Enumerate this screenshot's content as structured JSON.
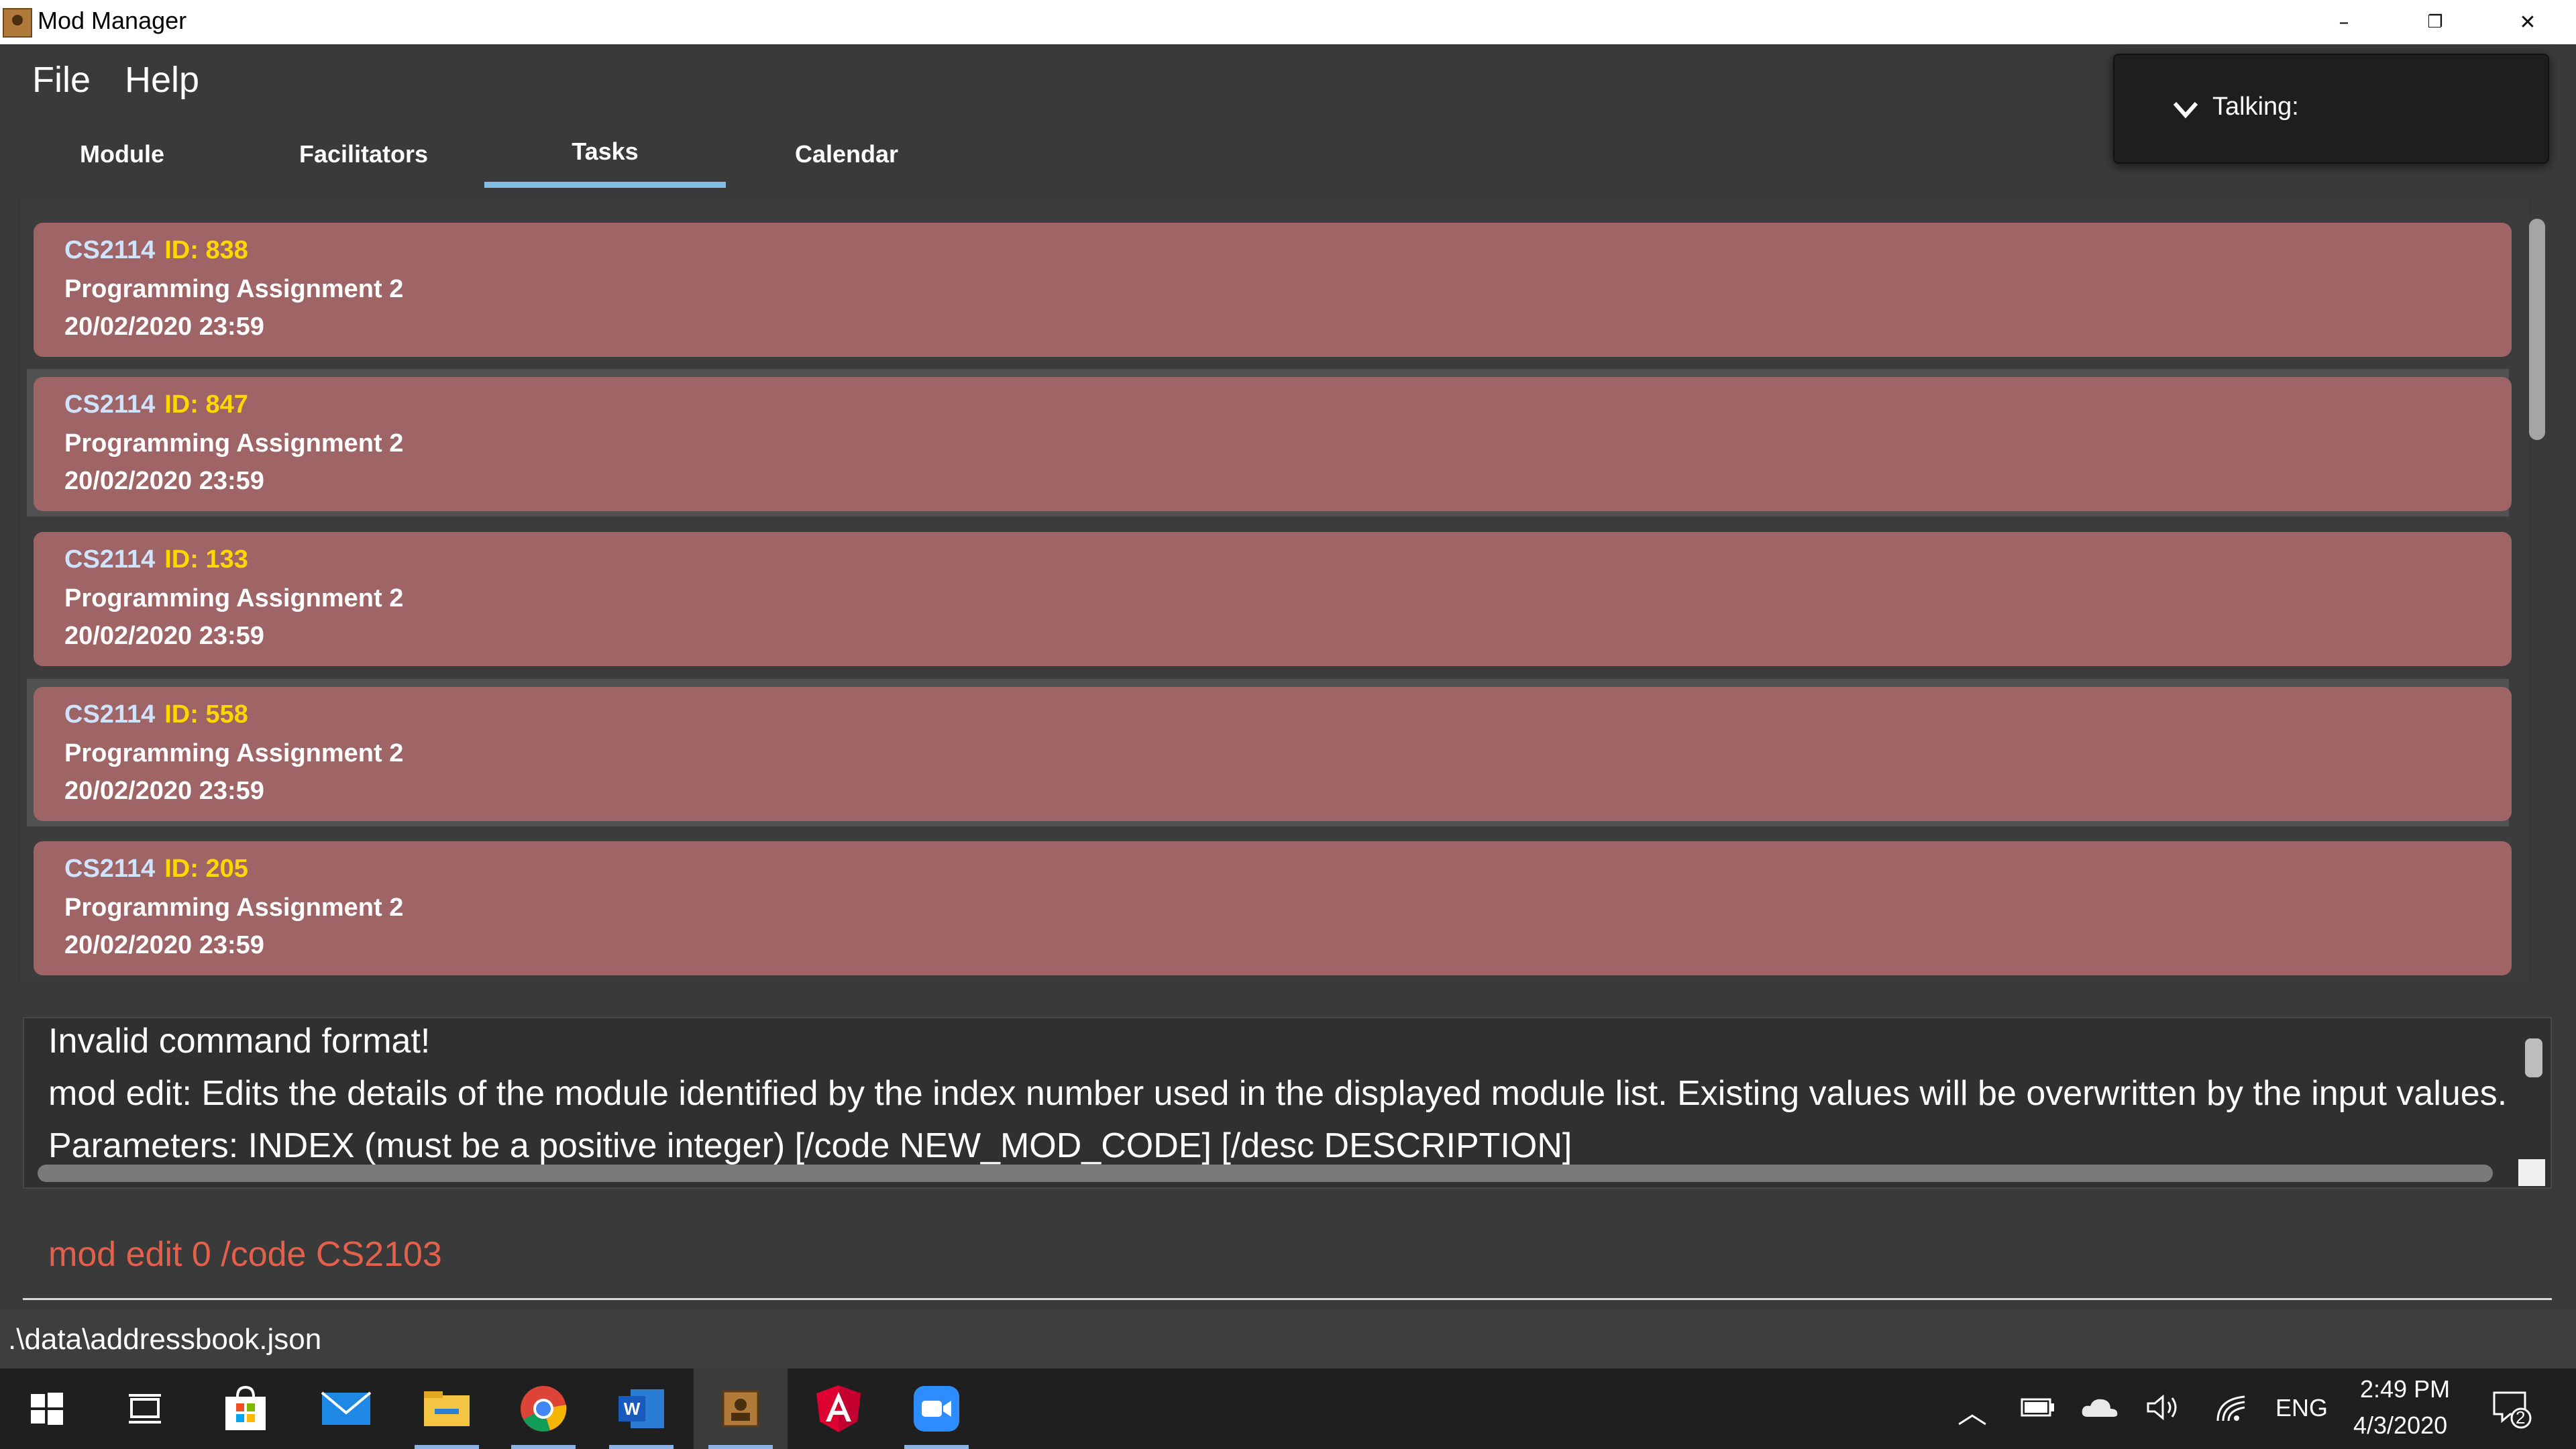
{
  "window": {
    "title": "Mod Manager",
    "minimize": "–",
    "restore": "❐",
    "close": "✕"
  },
  "menu": {
    "items": [
      "File",
      "Help"
    ]
  },
  "tabs": [
    {
      "label": "Module",
      "active": false
    },
    {
      "label": "Facilitators",
      "active": false
    },
    {
      "label": "Tasks",
      "active": true
    },
    {
      "label": "Calendar",
      "active": false
    }
  ],
  "talking": {
    "label": "Talking:"
  },
  "tasks": [
    {
      "code": "CS2114",
      "id": "ID: 838",
      "title": "Programming Assignment 2",
      "due": "20/02/2020 23:59"
    },
    {
      "code": "CS2114",
      "id": "ID: 847",
      "title": "Programming Assignment 2",
      "due": "20/02/2020 23:59"
    },
    {
      "code": "CS2114",
      "id": "ID: 133",
      "title": "Programming Assignment 2",
      "due": "20/02/2020 23:59"
    },
    {
      "code": "CS2114",
      "id": "ID: 558",
      "title": "Programming Assignment 2",
      "due": "20/02/2020 23:59"
    },
    {
      "code": "CS2114",
      "id": "ID: 205",
      "title": "Programming Assignment 2",
      "due": "20/02/2020 23:59"
    }
  ],
  "result": {
    "lines": [
      "Invalid command format!",
      "mod edit: Edits the details of the module identified by the index number used in the displayed module list. Existing values will be overwritten by the input values.",
      "Parameters: INDEX (must be a positive integer) [/code NEW_MOD_CODE] [/desc DESCRIPTION]"
    ]
  },
  "command": {
    "value": "mod edit 0 /code CS2103"
  },
  "status": {
    "path": ".\\data\\addressbook.json"
  },
  "taskbar": {
    "apps": [
      "windows-start",
      "task-view",
      "microsoft-store",
      "mail",
      "file-explorer",
      "chrome",
      "word",
      "mod-manager",
      "angular",
      "zoom"
    ],
    "language": "ENG",
    "time": "2:49 PM",
    "date": "4/3/2020",
    "notification_count": "2"
  },
  "colors": {
    "card": "#9e6466",
    "module_code": "#cfe3ff",
    "task_id": "#ffd700",
    "command_text": "#e5604a",
    "tab_underline": "#7fbfe6"
  }
}
